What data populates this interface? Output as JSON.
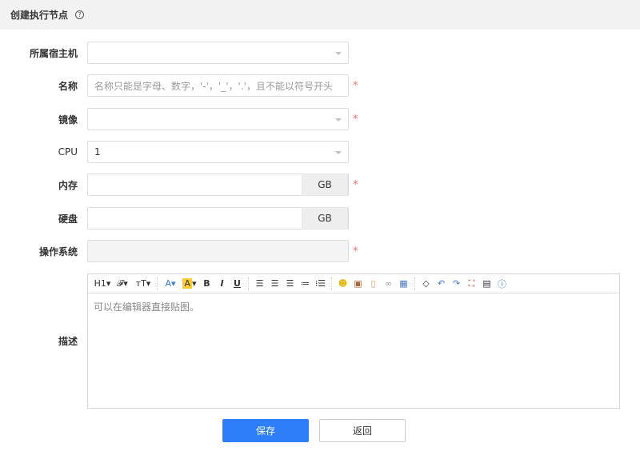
{
  "header": {
    "title": "创建执行节点",
    "help_icon": "question-circle-icon"
  },
  "form": {
    "host": {
      "label": "所属宿主机",
      "value": ""
    },
    "name": {
      "label": "名称",
      "placeholder": "名称只能是字母、数字，'-'，'_'，'.'，且不能以符号开头",
      "required": "*"
    },
    "image": {
      "label": "镜像",
      "value": "",
      "required": "*"
    },
    "cpu": {
      "label": "CPU",
      "value": "1"
    },
    "memory": {
      "label": "内存",
      "value": "",
      "unit": "GB",
      "required": "*"
    },
    "disk": {
      "label": "硬盘",
      "value": "",
      "unit": "GB"
    },
    "os": {
      "label": "操作系统",
      "value": "",
      "required": "*"
    },
    "desc": {
      "label": "描述",
      "placeholder": "可以在编辑器直接贴图。"
    }
  },
  "toolbar": {
    "h1": "H1▾",
    "font": "𝓕▾",
    "size": "тT▾",
    "fontcolor": "A▾",
    "bgcolor": "A",
    "bold": "B",
    "italic": "I",
    "underline": "U"
  },
  "buttons": {
    "save": "保存",
    "back": "返回"
  },
  "colors": {
    "primary": "#2d7ef8",
    "required": "#f56c6c"
  }
}
